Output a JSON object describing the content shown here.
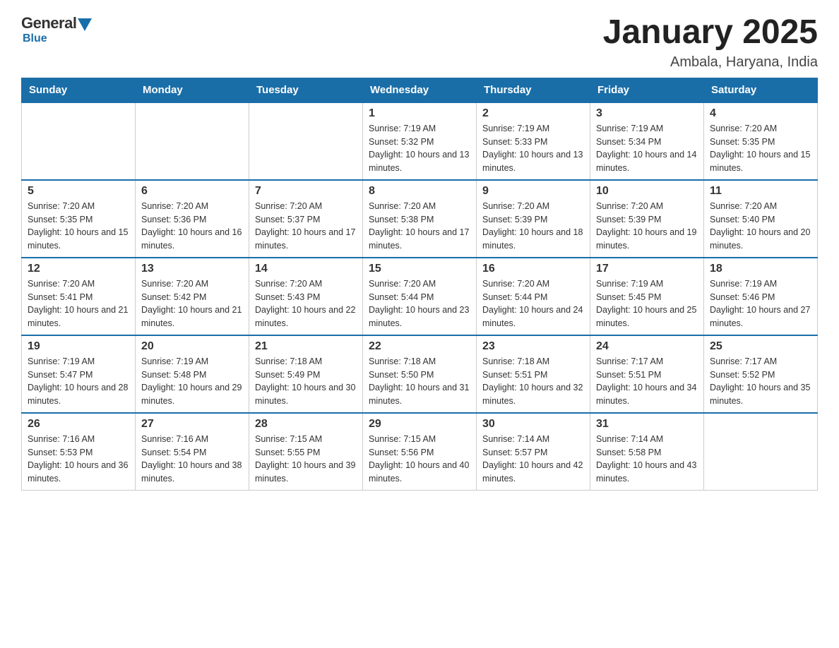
{
  "logo": {
    "general": "General",
    "blue": "Blue"
  },
  "header": {
    "title": "January 2025",
    "subtitle": "Ambala, Haryana, India"
  },
  "weekdays": [
    "Sunday",
    "Monday",
    "Tuesday",
    "Wednesday",
    "Thursday",
    "Friday",
    "Saturday"
  ],
  "weeks": [
    [
      {
        "day": "",
        "sunrise": "",
        "sunset": "",
        "daylight": ""
      },
      {
        "day": "",
        "sunrise": "",
        "sunset": "",
        "daylight": ""
      },
      {
        "day": "",
        "sunrise": "",
        "sunset": "",
        "daylight": ""
      },
      {
        "day": "1",
        "sunrise": "Sunrise: 7:19 AM",
        "sunset": "Sunset: 5:32 PM",
        "daylight": "Daylight: 10 hours and 13 minutes."
      },
      {
        "day": "2",
        "sunrise": "Sunrise: 7:19 AM",
        "sunset": "Sunset: 5:33 PM",
        "daylight": "Daylight: 10 hours and 13 minutes."
      },
      {
        "day": "3",
        "sunrise": "Sunrise: 7:19 AM",
        "sunset": "Sunset: 5:34 PM",
        "daylight": "Daylight: 10 hours and 14 minutes."
      },
      {
        "day": "4",
        "sunrise": "Sunrise: 7:20 AM",
        "sunset": "Sunset: 5:35 PM",
        "daylight": "Daylight: 10 hours and 15 minutes."
      }
    ],
    [
      {
        "day": "5",
        "sunrise": "Sunrise: 7:20 AM",
        "sunset": "Sunset: 5:35 PM",
        "daylight": "Daylight: 10 hours and 15 minutes."
      },
      {
        "day": "6",
        "sunrise": "Sunrise: 7:20 AM",
        "sunset": "Sunset: 5:36 PM",
        "daylight": "Daylight: 10 hours and 16 minutes."
      },
      {
        "day": "7",
        "sunrise": "Sunrise: 7:20 AM",
        "sunset": "Sunset: 5:37 PM",
        "daylight": "Daylight: 10 hours and 17 minutes."
      },
      {
        "day": "8",
        "sunrise": "Sunrise: 7:20 AM",
        "sunset": "Sunset: 5:38 PM",
        "daylight": "Daylight: 10 hours and 17 minutes."
      },
      {
        "day": "9",
        "sunrise": "Sunrise: 7:20 AM",
        "sunset": "Sunset: 5:39 PM",
        "daylight": "Daylight: 10 hours and 18 minutes."
      },
      {
        "day": "10",
        "sunrise": "Sunrise: 7:20 AM",
        "sunset": "Sunset: 5:39 PM",
        "daylight": "Daylight: 10 hours and 19 minutes."
      },
      {
        "day": "11",
        "sunrise": "Sunrise: 7:20 AM",
        "sunset": "Sunset: 5:40 PM",
        "daylight": "Daylight: 10 hours and 20 minutes."
      }
    ],
    [
      {
        "day": "12",
        "sunrise": "Sunrise: 7:20 AM",
        "sunset": "Sunset: 5:41 PM",
        "daylight": "Daylight: 10 hours and 21 minutes."
      },
      {
        "day": "13",
        "sunrise": "Sunrise: 7:20 AM",
        "sunset": "Sunset: 5:42 PM",
        "daylight": "Daylight: 10 hours and 21 minutes."
      },
      {
        "day": "14",
        "sunrise": "Sunrise: 7:20 AM",
        "sunset": "Sunset: 5:43 PM",
        "daylight": "Daylight: 10 hours and 22 minutes."
      },
      {
        "day": "15",
        "sunrise": "Sunrise: 7:20 AM",
        "sunset": "Sunset: 5:44 PM",
        "daylight": "Daylight: 10 hours and 23 minutes."
      },
      {
        "day": "16",
        "sunrise": "Sunrise: 7:20 AM",
        "sunset": "Sunset: 5:44 PM",
        "daylight": "Daylight: 10 hours and 24 minutes."
      },
      {
        "day": "17",
        "sunrise": "Sunrise: 7:19 AM",
        "sunset": "Sunset: 5:45 PM",
        "daylight": "Daylight: 10 hours and 25 minutes."
      },
      {
        "day": "18",
        "sunrise": "Sunrise: 7:19 AM",
        "sunset": "Sunset: 5:46 PM",
        "daylight": "Daylight: 10 hours and 27 minutes."
      }
    ],
    [
      {
        "day": "19",
        "sunrise": "Sunrise: 7:19 AM",
        "sunset": "Sunset: 5:47 PM",
        "daylight": "Daylight: 10 hours and 28 minutes."
      },
      {
        "day": "20",
        "sunrise": "Sunrise: 7:19 AM",
        "sunset": "Sunset: 5:48 PM",
        "daylight": "Daylight: 10 hours and 29 minutes."
      },
      {
        "day": "21",
        "sunrise": "Sunrise: 7:18 AM",
        "sunset": "Sunset: 5:49 PM",
        "daylight": "Daylight: 10 hours and 30 minutes."
      },
      {
        "day": "22",
        "sunrise": "Sunrise: 7:18 AM",
        "sunset": "Sunset: 5:50 PM",
        "daylight": "Daylight: 10 hours and 31 minutes."
      },
      {
        "day": "23",
        "sunrise": "Sunrise: 7:18 AM",
        "sunset": "Sunset: 5:51 PM",
        "daylight": "Daylight: 10 hours and 32 minutes."
      },
      {
        "day": "24",
        "sunrise": "Sunrise: 7:17 AM",
        "sunset": "Sunset: 5:51 PM",
        "daylight": "Daylight: 10 hours and 34 minutes."
      },
      {
        "day": "25",
        "sunrise": "Sunrise: 7:17 AM",
        "sunset": "Sunset: 5:52 PM",
        "daylight": "Daylight: 10 hours and 35 minutes."
      }
    ],
    [
      {
        "day": "26",
        "sunrise": "Sunrise: 7:16 AM",
        "sunset": "Sunset: 5:53 PM",
        "daylight": "Daylight: 10 hours and 36 minutes."
      },
      {
        "day": "27",
        "sunrise": "Sunrise: 7:16 AM",
        "sunset": "Sunset: 5:54 PM",
        "daylight": "Daylight: 10 hours and 38 minutes."
      },
      {
        "day": "28",
        "sunrise": "Sunrise: 7:15 AM",
        "sunset": "Sunset: 5:55 PM",
        "daylight": "Daylight: 10 hours and 39 minutes."
      },
      {
        "day": "29",
        "sunrise": "Sunrise: 7:15 AM",
        "sunset": "Sunset: 5:56 PM",
        "daylight": "Daylight: 10 hours and 40 minutes."
      },
      {
        "day": "30",
        "sunrise": "Sunrise: 7:14 AM",
        "sunset": "Sunset: 5:57 PM",
        "daylight": "Daylight: 10 hours and 42 minutes."
      },
      {
        "day": "31",
        "sunrise": "Sunrise: 7:14 AM",
        "sunset": "Sunset: 5:58 PM",
        "daylight": "Daylight: 10 hours and 43 minutes."
      },
      {
        "day": "",
        "sunrise": "",
        "sunset": "",
        "daylight": ""
      }
    ]
  ]
}
